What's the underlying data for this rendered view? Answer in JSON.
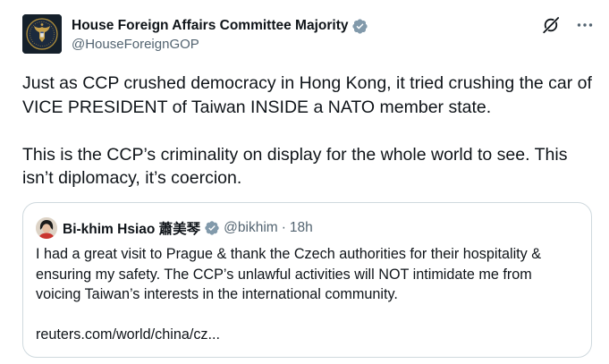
{
  "author": {
    "display_name": "House Foreign Affairs Committee Majority",
    "handle": "@HouseForeignGOP"
  },
  "tweet": {
    "paragraph1_line1": "Just as CCP crushed democracy in Hong Kong, it tried crushing the car of",
    "paragraph1_line2": "VICE PRESIDENT of Taiwan INSIDE a NATO member state.",
    "paragraph2_line1": "This is the CCP’s criminality on display for the whole world to see. This",
    "paragraph2_line2": "isn’t diplomacy, it’s coercion."
  },
  "quoted": {
    "display_name": "Bi-khim Hsiao 蕭美琴",
    "handle": "@bikhim",
    "separator": "·",
    "time": "18h",
    "text_line1": "I had a great visit to Prague & thank the Czech authorities for their hospitality &",
    "text_line2": "ensuring my safety.  The CCP’s unlawful activities will NOT intimidate me from",
    "text_line3": "voicing Taiwan’s interests in the international community.",
    "link": "reuters.com/world/china/cz..."
  },
  "icons": {
    "verified": "verified-badge-icon",
    "grok": "grok-icon",
    "more": "more-options-icon"
  },
  "colors": {
    "text_primary": "#0f1419",
    "text_secondary": "#536471",
    "verified_badge": "#829aab",
    "border": "#cfd9de"
  }
}
